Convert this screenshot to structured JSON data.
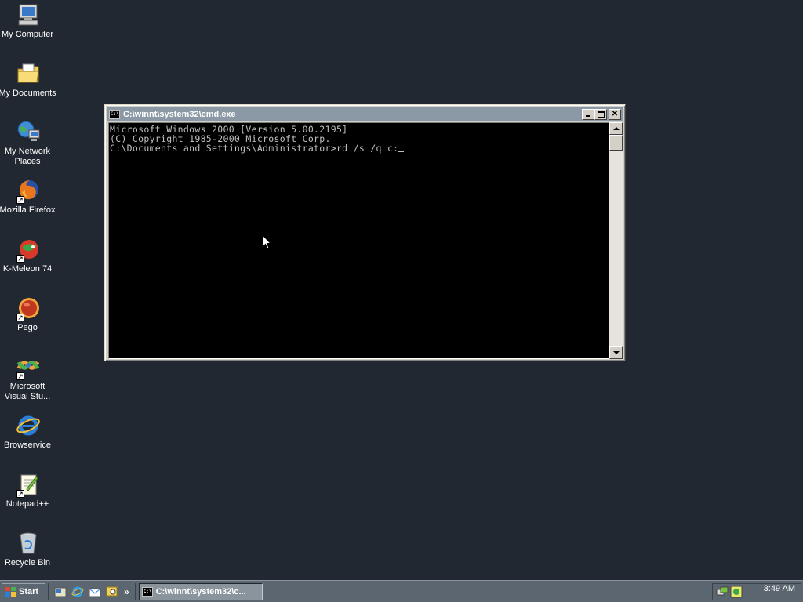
{
  "desktop": {
    "background_color": "#222831",
    "icons": [
      {
        "label": "My Computer",
        "icon": "my-computer-icon"
      },
      {
        "label": "My Documents",
        "icon": "my-documents-icon"
      },
      {
        "label": "My Network Places",
        "icon": "network-places-icon"
      },
      {
        "label": "Mozilla Firefox",
        "icon": "firefox-icon"
      },
      {
        "label": "K-Meleon 74",
        "icon": "k-meleon-icon"
      },
      {
        "label": "Pego",
        "icon": "pego-icon"
      },
      {
        "label": "Microsoft Visual Stu...",
        "icon": "visual-studio-icon"
      },
      {
        "label": "Browservice",
        "icon": "internet-explorer-icon"
      },
      {
        "label": "Notepad++",
        "icon": "notepad-plus-plus-icon"
      },
      {
        "label": "Recycle Bin",
        "icon": "recycle-bin-icon"
      }
    ]
  },
  "cmd_window": {
    "title": "C:\\winnt\\system32\\cmd.exe",
    "app_icon_text": "C:\\",
    "lines": [
      "Microsoft Windows 2000 [Version 5.00.2195]",
      "(C) Copyright 1985-2000 Microsoft Corp.",
      "",
      "C:\\Documents and Settings\\Administrator>rd /s /q c:"
    ]
  },
  "taskbar": {
    "start_label": "Start",
    "task_button_label": "C:\\winnt\\system32\\c...",
    "quick_launch_more": "»",
    "clock": "3:49 AM"
  }
}
